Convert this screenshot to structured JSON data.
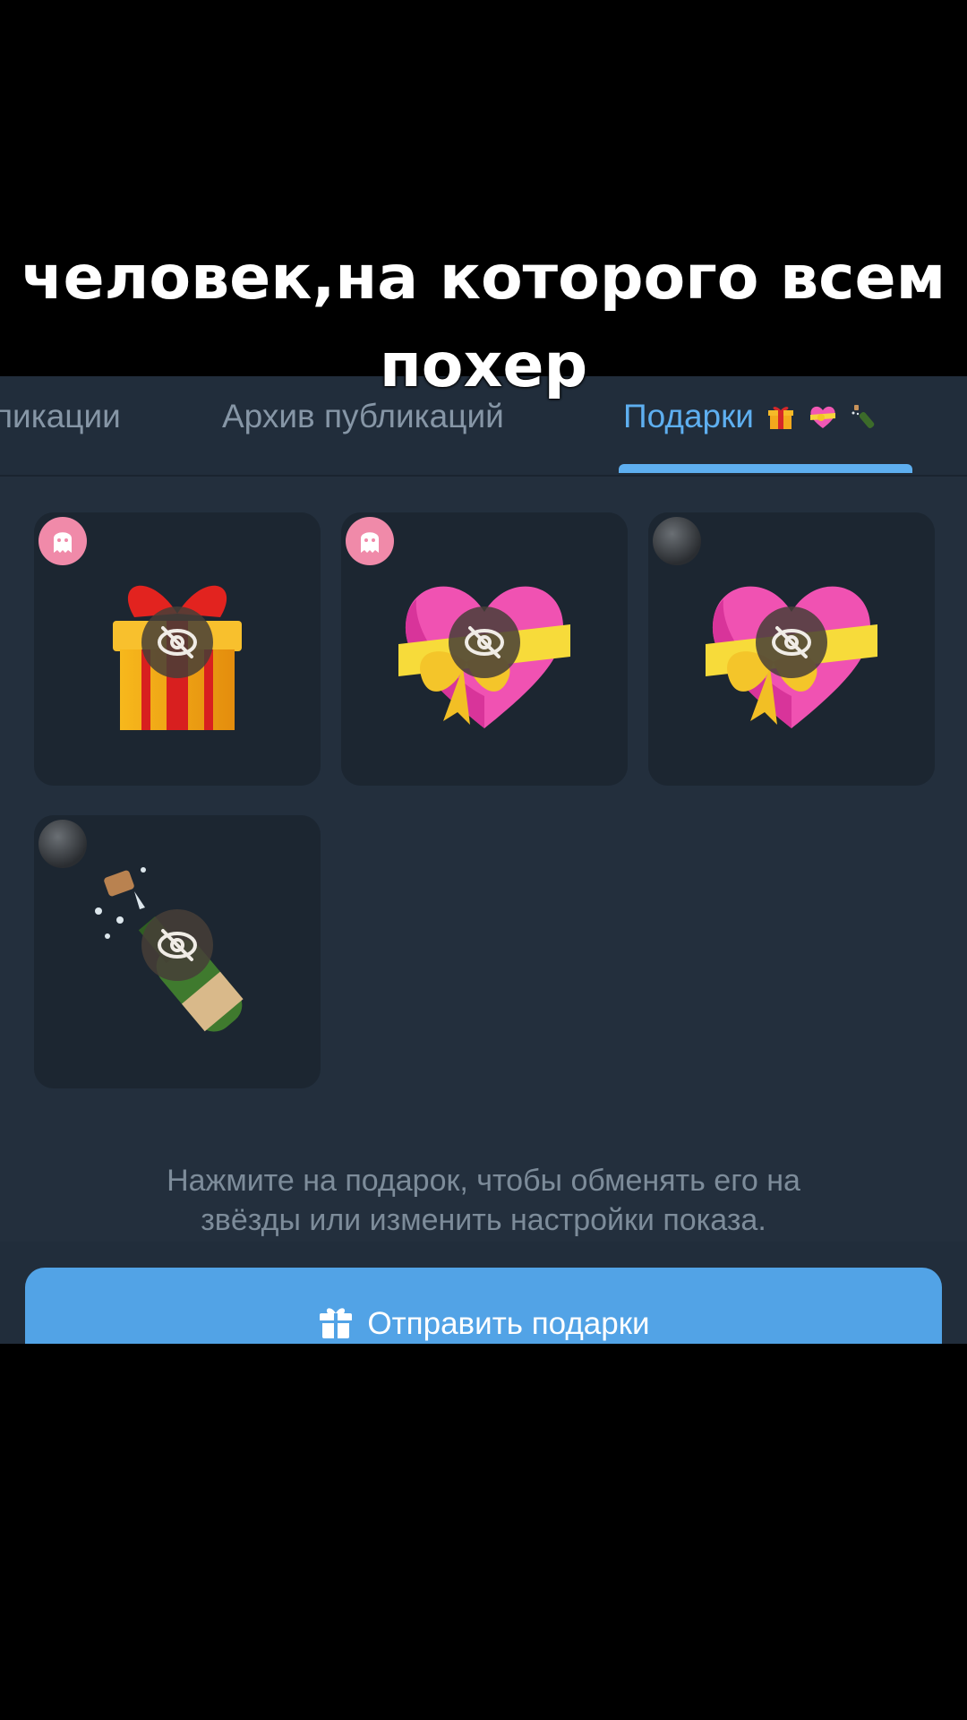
{
  "caption": {
    "line1": "человек,на которого всем",
    "line2": "похер"
  },
  "tabs": [
    {
      "label": "пикации"
    },
    {
      "label": "Архив публикаций"
    },
    {
      "label": "Подарки",
      "emoji": [
        "gift-icon",
        "heart-ribbon-icon",
        "champagne-icon"
      ],
      "active": true
    }
  ],
  "gifts": [
    {
      "art": "gift-box-icon",
      "badge": "ghost-badge"
    },
    {
      "art": "heart-ribbon-icon",
      "badge": "ghost-badge"
    },
    {
      "art": "heart-ribbon-icon",
      "badge": "dark-badge"
    },
    {
      "art": "champagne-bottle-icon",
      "badge": "dark-badge"
    }
  ],
  "hint": {
    "line1": "Нажмите на подарок, чтобы обменять его на",
    "line2": "звёзды или изменить настройки показа."
  },
  "send_button": {
    "label": "Отправить подарки",
    "icon": "gift-icon"
  },
  "colors": {
    "accent": "#5eaff0",
    "button": "#52a3e6",
    "background": "#232f3d",
    "card": "#1c2631"
  }
}
